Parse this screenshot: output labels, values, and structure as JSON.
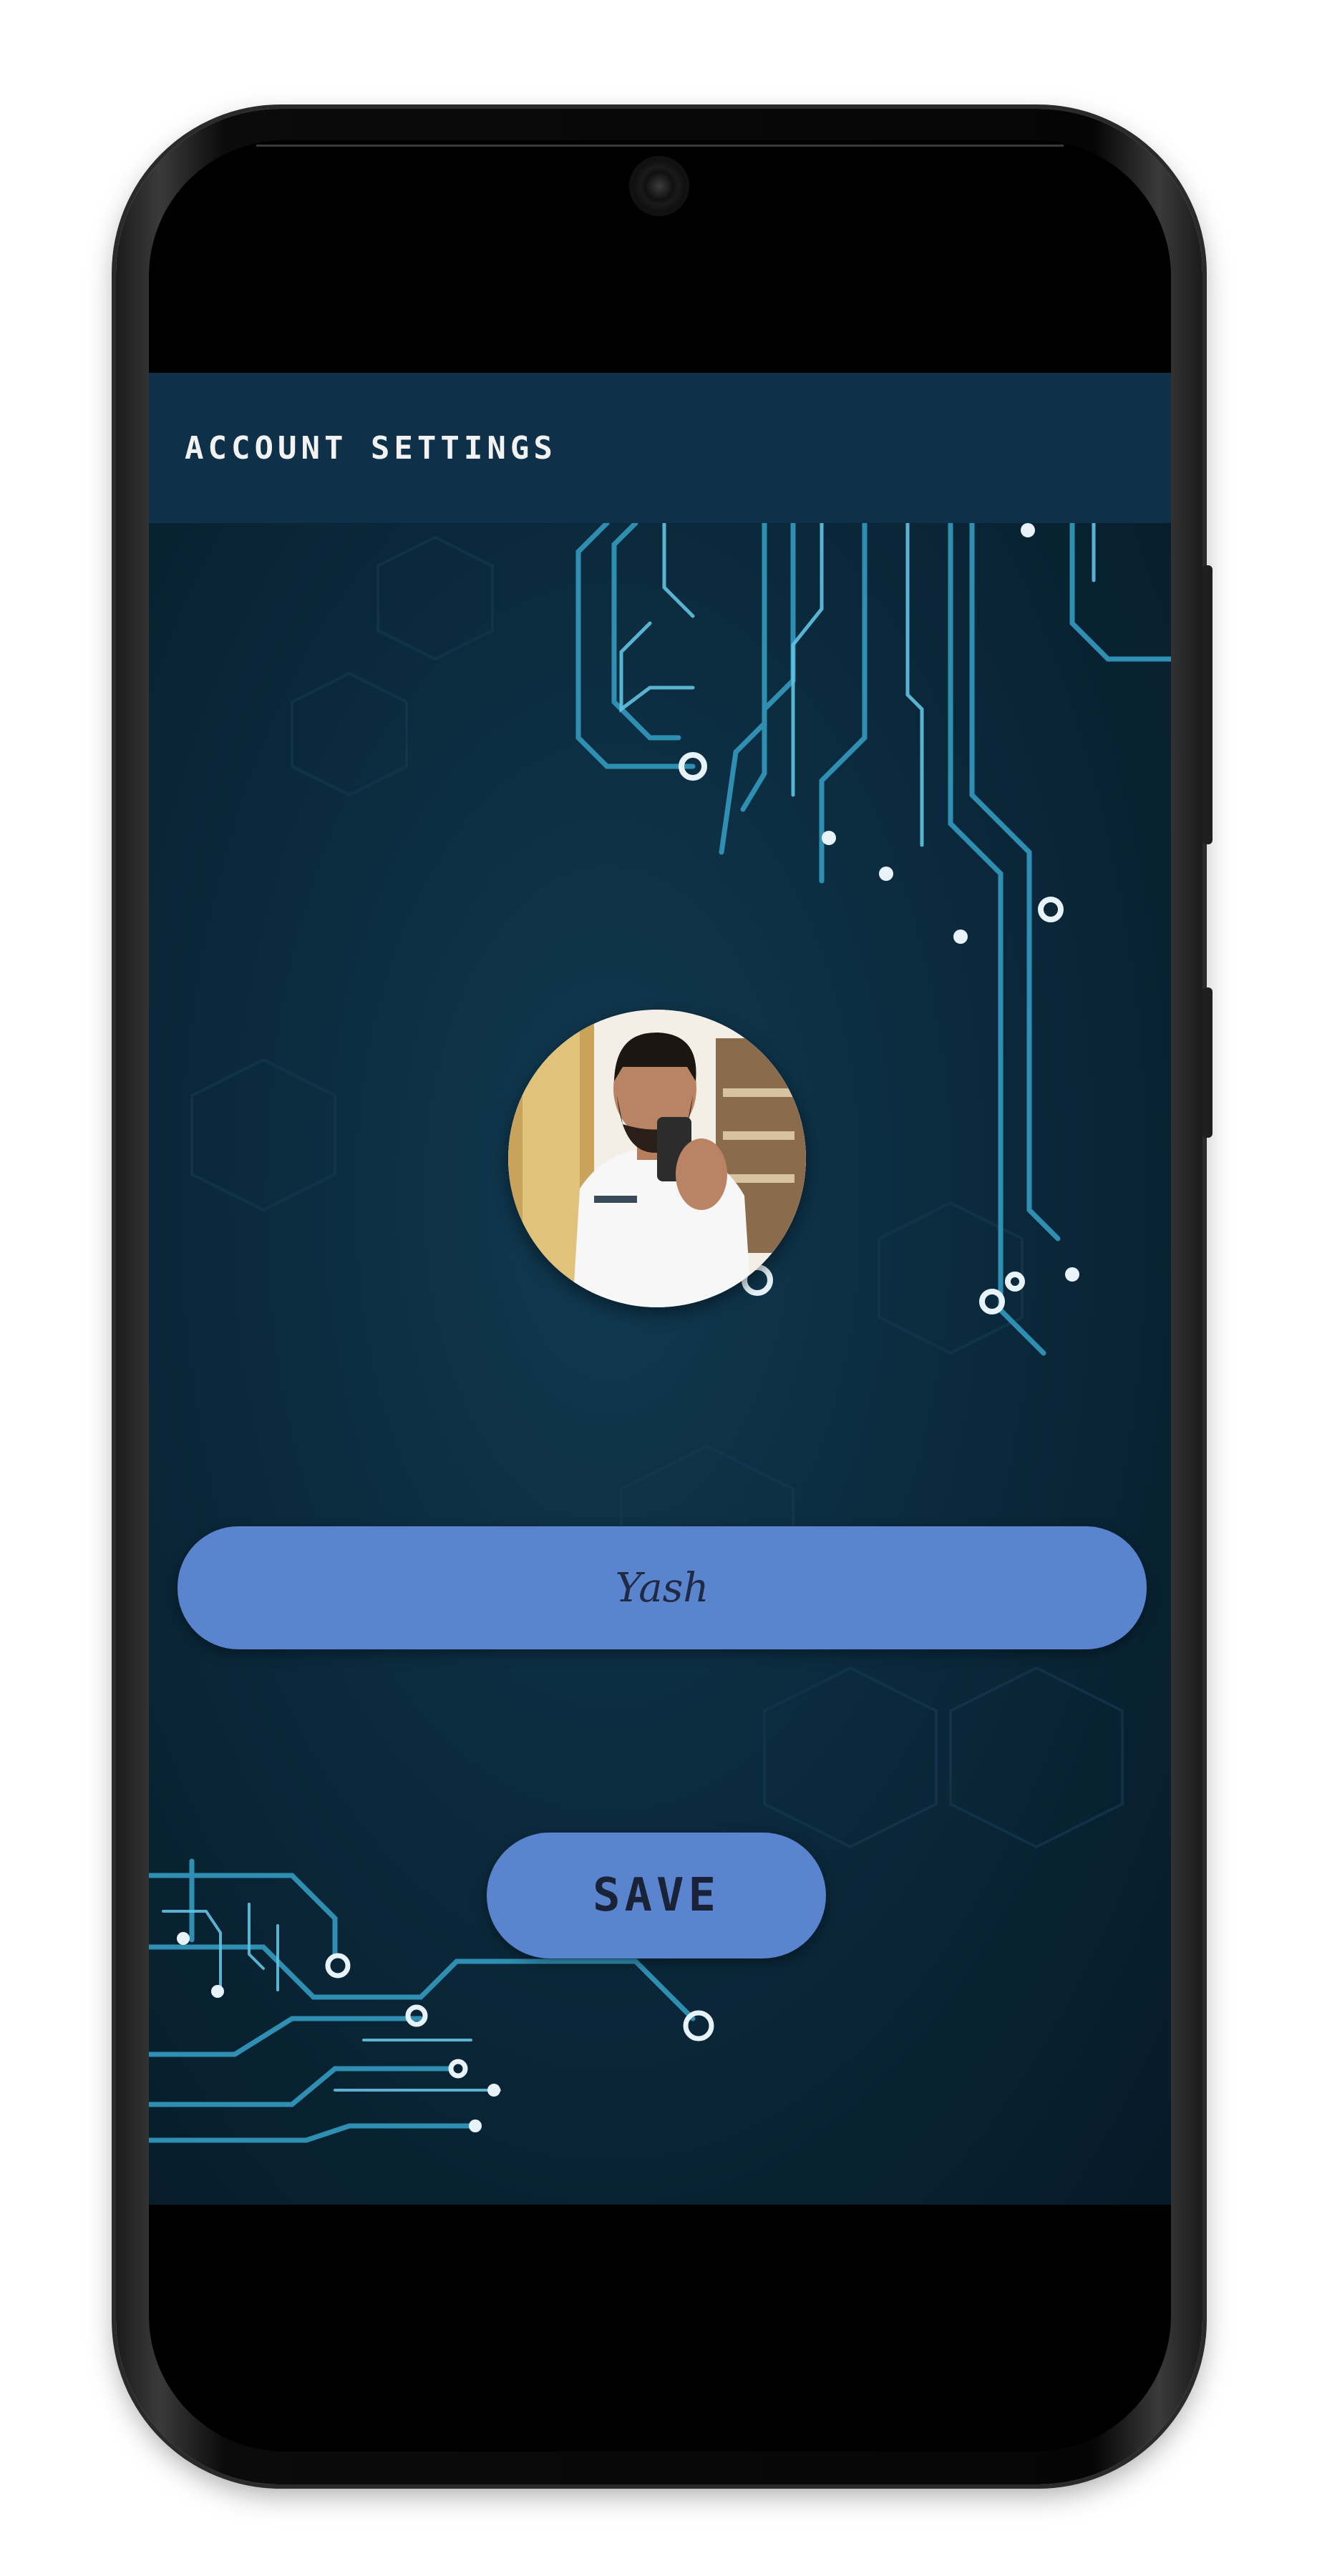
{
  "app_bar": {
    "title": "Account Settings"
  },
  "profile": {
    "avatar_icon": "user-photo",
    "name_value": "Yash"
  },
  "actions": {
    "save_label": "SAVE"
  },
  "colors": {
    "app_bar": "#0e3149",
    "background": "#0b2a3d",
    "accent": "#5b84cf",
    "circuit": "#3aa6c9"
  }
}
